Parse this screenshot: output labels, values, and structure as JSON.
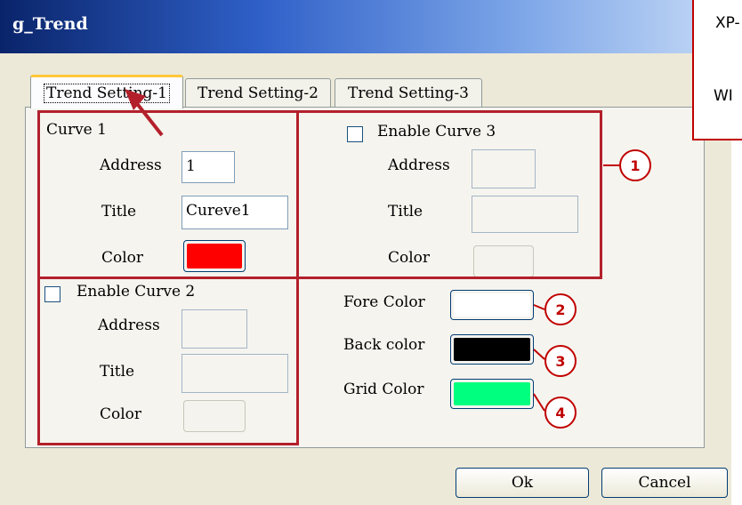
{
  "window": {
    "title": "g_Trend"
  },
  "tabs": [
    {
      "label": "Trend Setting-1",
      "active": true
    },
    {
      "label": "Trend Setting-2",
      "active": false
    },
    {
      "label": "Trend Setting-3",
      "active": false
    }
  ],
  "curve1": {
    "heading": "Curve 1",
    "address_label": "Address",
    "address_value": "1",
    "title_label": "Title",
    "title_value": "Cureve1",
    "color_label": "Color",
    "color": "#ff0000"
  },
  "curve2": {
    "enable_label": "Enable Curve 2",
    "enabled": false,
    "address_label": "Address",
    "title_label": "Title",
    "color_label": "Color"
  },
  "curve3": {
    "enable_label": "Enable Curve 3",
    "enabled": false,
    "address_label": "Address",
    "title_label": "Title",
    "color_label": "Color"
  },
  "colors": {
    "fore_label": "Fore Color",
    "fore": "#ffffff",
    "back_label": "Back color",
    "back": "#000000",
    "grid_label": "Grid Color",
    "grid": "#00ff7f"
  },
  "buttons": {
    "ok": "Ok",
    "cancel": "Cancel"
  },
  "callouts": [
    "1",
    "2",
    "3",
    "4"
  ],
  "note": {
    "line1": "XP-",
    "line2": "WI"
  },
  "accent": {
    "annotation_red": "#c00000",
    "title_blue": "#0a246a"
  }
}
